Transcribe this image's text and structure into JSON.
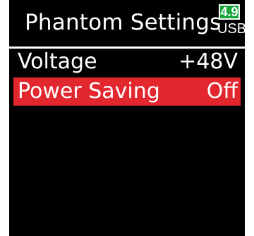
{
  "screen": {
    "title": "Phantom Settings",
    "battery": {
      "level_text": "4.9",
      "source": "USB",
      "indicator_color": "#16a63b"
    }
  },
  "menu": {
    "items": [
      {
        "label": "Voltage",
        "value": "+48V",
        "selected": false
      },
      {
        "label": "Power Saving",
        "value": "Off",
        "selected": true
      }
    ]
  },
  "colors": {
    "background": "#000000",
    "text": "#ffffff",
    "selection": "#e2272f"
  }
}
